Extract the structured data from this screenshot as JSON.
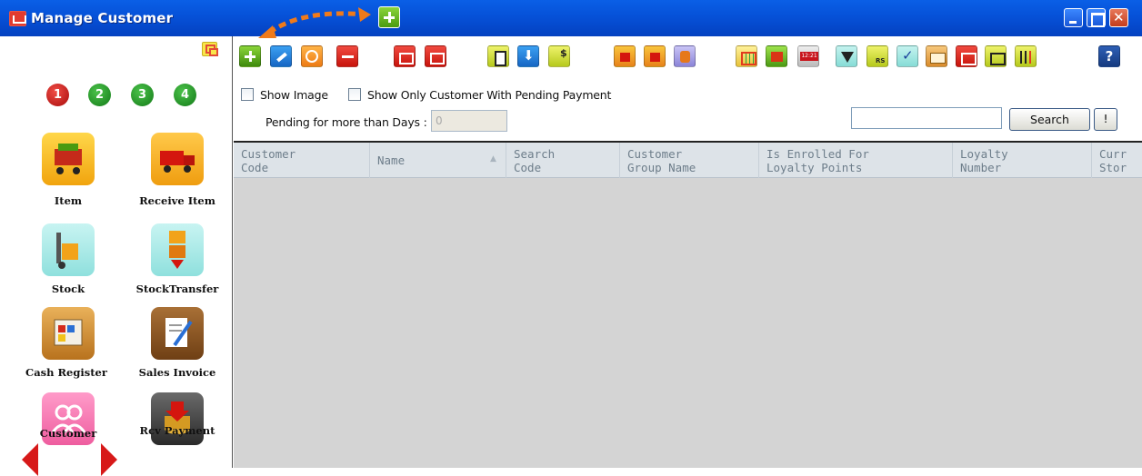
{
  "window": {
    "title": "Manage Customer"
  },
  "sidebar": {
    "pages": [
      "1",
      "2",
      "3",
      "4"
    ],
    "items": [
      {
        "label": "Item",
        "icon": "shopping-cart-icon"
      },
      {
        "label": "Receive Item",
        "icon": "truck-icon"
      },
      {
        "label": "Stock",
        "icon": "hand-truck-icon"
      },
      {
        "label": "StockTransfer",
        "icon": "transfer-boxes-icon"
      },
      {
        "label": "Cash Register",
        "icon": "cash-register-icon"
      },
      {
        "label": "Sales Invoice",
        "icon": "invoice-pen-icon"
      },
      {
        "label": "Customer",
        "icon": "people-icon"
      },
      {
        "label": "Rcv Payment",
        "icon": "payment-box-icon"
      }
    ]
  },
  "filters": {
    "show_image_label": "Show Image",
    "pending_payment_label": "Show Only Customer With Pending Payment",
    "pending_days_label": "Pending for more than Days :",
    "pending_days_value": "0",
    "search_value": "",
    "search_button": "Search",
    "extra_button": "!"
  },
  "toolbar": {
    "help_label": "?"
  },
  "grid": {
    "columns": [
      "Customer\nCode",
      "Name",
      "Search\nCode",
      "Customer\nGroup Name",
      "Is Enrolled For\nLoyalty Points",
      "Loyalty\nNumber",
      "Curr\nStor"
    ],
    "rows": []
  },
  "colors": {
    "titlebar": "#0651d8",
    "grid_background": "#d4d4d4",
    "header_background": "#dde3e8",
    "accent_green": "#4a9a10",
    "arrow_orange": "#f07a1a"
  }
}
